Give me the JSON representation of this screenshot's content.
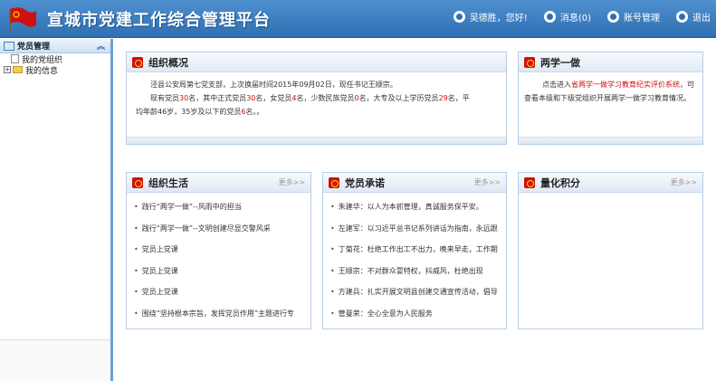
{
  "header": {
    "title": "宣城市党建工作综合管理平台",
    "nav": {
      "user": "吴德胜，您好!",
      "messages": "消息(0)",
      "account": "账号管理",
      "logout": "退出"
    }
  },
  "sidebar": {
    "section": "党员管理",
    "items": [
      {
        "label": "我的党组织"
      },
      {
        "label": "我的信息"
      }
    ]
  },
  "overview": {
    "title": "组织概况",
    "line1": "泾县公安局第七党支部，上次换届时间2015年09月02日，现任书记王顺宗。",
    "line2": {
      "p1": "现有党员",
      "v1": "30",
      "p2": "名，其中正式党员",
      "v2": "30",
      "p3": "名，女党员",
      "v3": "4",
      "p4": "名，少数民族党员",
      "v4": "0",
      "p5": "名，大专及以上学历党员",
      "v5": "29",
      "p6": "名，平",
      "p7": "均年龄46岁，35岁及以下的党员",
      "v6": "6",
      "p8": "名。。"
    }
  },
  "study": {
    "title": "两学一做",
    "text1": "点击进入",
    "link": "省两学一做学习教育纪实评价系统",
    "text2": "，可查看本级和下级党组织开展两学一做学习教育情况。"
  },
  "life": {
    "title": "组织生活",
    "more": "更多>>",
    "items": [
      "践行“两学一做”--风雨中的担当",
      "践行“两学一做”--文明创建尽显交警风采",
      "党员上党课",
      "党员上党课",
      "党员上党课",
      "围绕“坚持根本宗旨，发挥党员作用”主题进行专"
    ]
  },
  "promise": {
    "title": "党员承诺",
    "more": "更多>>",
    "items": [
      "朱建华：以人为本抓管理，真诚服务保平安。",
      "左建军：以习近平总书记系列讲话为指南，永远跟",
      "丁菊花：杜绝工作出工不出力，晚来早走，工作期",
      "王顺宗：不对群众耍特权，抖威风，杜绝出现",
      "方建兵：扎实开展文明县创建交通宣传活动，倡导",
      "管曼荣：全心全意为人民服务"
    ]
  },
  "score": {
    "title": "量化积分",
    "more": "更多>>"
  },
  "colors": {
    "header_blue": "#2f6fb3",
    "party_red": "#d10f0f"
  }
}
